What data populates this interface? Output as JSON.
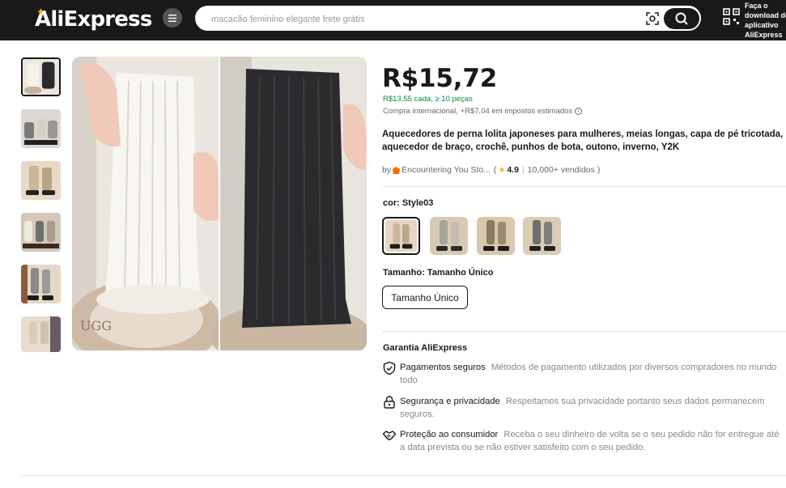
{
  "header": {
    "logo": "AliExpress",
    "search_placeholder": "macacão feminino elegante frete grátis",
    "app_promo": "Faça o download do aplicativo AliExpress"
  },
  "product": {
    "price": "R$15,72",
    "bulk_price": "R$13,55 cada, ≥ 10 peças",
    "tax_note": "Compra internacional, +R$7,04 em impostos estimados",
    "title": "Aquecedores de perna lolita japoneses para mulheres, meias longas, capa de pé tricotada, aquecedor de braço, crochê, punhos de bota, outono, inverno, Y2K",
    "store_prefix": "by",
    "store_name": "Encountering You Sto...",
    "rating": "4.9",
    "sold": "10,000+ vendidos",
    "open_paren": "(",
    "separator": "|",
    "close_paren": ")",
    "color_label": "cor: Style03",
    "size_label": "Tamanho: Tamanho Único",
    "size_option": "Tamanho Único"
  },
  "guarantee": {
    "label": "Garantia AliExpress",
    "items": [
      {
        "title": "Pagamentos seguros",
        "desc": "Métodos de pagamento utilizados por diversos compradores no mundo todo",
        "icon": "shield-check-icon"
      },
      {
        "title": "Segurança e privacidade",
        "desc": "Respeitamos sua privacidade portanto seus dados permanecem seguros.",
        "icon": "lock-icon"
      },
      {
        "title": "Proteção ao consumidor",
        "desc": "Receba o seu dinheiro de volta se o seu pedido não for entregue até a data prevista ou se não estiver satisfeito com o seu pedido.",
        "icon": "handshake-icon"
      }
    ]
  },
  "colors": {
    "header_bg": "#191919",
    "brand_star": "#ffb400",
    "bulk_green": "#008a3e"
  }
}
